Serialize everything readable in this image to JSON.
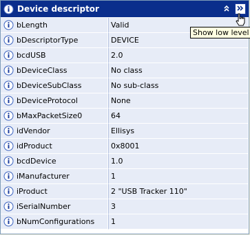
{
  "header": {
    "title": "Device descriptor",
    "collapse_icon": "double-chevron-up-icon",
    "low_level_icon": "double-chevron-right-icon"
  },
  "tooltip": "Show low level",
  "fields": [
    {
      "name": "bLength",
      "value": "Valid"
    },
    {
      "name": "bDescriptorType",
      "value": "DEVICE"
    },
    {
      "name": "bcdUSB",
      "value": "2.0"
    },
    {
      "name": "bDeviceClass",
      "value": "No class"
    },
    {
      "name": "bDeviceSubClass",
      "value": "No sub-class"
    },
    {
      "name": "bDeviceProtocol",
      "value": "None"
    },
    {
      "name": "bMaxPacketSize0",
      "value": "64"
    },
    {
      "name": "idVendor",
      "value": "Ellisys"
    },
    {
      "name": "idProduct",
      "value": "0x8001"
    },
    {
      "name": "bcdDevice",
      "value": "1.0"
    },
    {
      "name": "iManufacturer",
      "value": "1"
    },
    {
      "name": "iProduct",
      "value": "2 \"USB Tracker 110\""
    },
    {
      "name": "iSerialNumber",
      "value": "3"
    },
    {
      "name": "bNumConfigurations",
      "value": "1"
    }
  ],
  "colors": {
    "header_bg": "#0a2e8c",
    "row_bg": "#e7ecf7",
    "tooltip_bg": "#ffffe1"
  }
}
